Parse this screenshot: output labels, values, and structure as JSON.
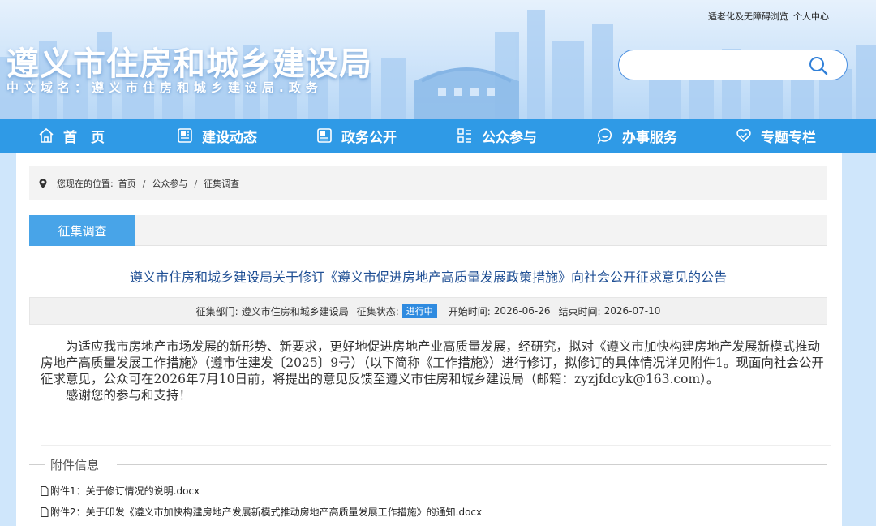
{
  "header": {
    "accessibility_link": "适老化及无障碍浏览",
    "user_center_link": "个人中心",
    "site_title": "遵义市住房和城乡建设局",
    "site_domain": "中文域名：遵义市住房和城乡建设局.政务",
    "search": {
      "placeholder": "",
      "value": ""
    }
  },
  "nav": {
    "items": [
      {
        "label": "首　页",
        "icon": "home-icon"
      },
      {
        "label": "建设动态",
        "icon": "news-icon"
      },
      {
        "label": "政务公开",
        "icon": "document-icon"
      },
      {
        "label": "公众参与",
        "icon": "list-icon"
      },
      {
        "label": "办事服务",
        "icon": "chat-icon"
      },
      {
        "label": "专题专栏",
        "icon": "heart-icon"
      }
    ],
    "colors": {
      "background": "#2f9ae6",
      "text": "#ffffff"
    }
  },
  "breadcrumb": {
    "prefix": "您现在的位置:",
    "items": [
      "首页",
      "公众参与",
      "征集调查"
    ],
    "separator": "/"
  },
  "section": {
    "tab_label": "征集调查",
    "accent": "#48a4e8"
  },
  "article": {
    "title": "遵义市住房和城乡建设局关于修订《遵义市促进房地产高质量发展政策措施》向社会公开征求意见的公告",
    "meta": {
      "dept_label": "征集部门:",
      "dept_value": "遵义市住房和城乡建设局",
      "status_label": "征集状态:",
      "status_value": "进行中",
      "start_label": "开始时间:",
      "start_value": "2026-06-26",
      "end_label": "结束时间:",
      "end_value": "2026-07-10"
    },
    "paragraphs": [
      "为适应我市房地产市场发展的新形势、新要求，更好地促进房地产业高质量发展，经研究，拟对《遵义市加快构建房地产发展新模式推动房地产高质量发展工作措施》（遵市住建发〔2025〕9号）（以下简称《工作措施》）进行修订，拟修订的具体情况详见附件1。现面向社会公开征求意见，公众可在2026年7月10日前，将提出的意见反馈至遵义市住房和城乡建设局（邮箱：zyzjfdcyk@163.com）。",
      "感谢您的参与和支持！"
    ]
  },
  "attachments": {
    "legend": "附件信息",
    "items": [
      "附件1：关于修订情况的说明.docx",
      "附件2：关于印发《遵义市加快构建房地产发展新模式推动房地产高质量发展工作措施》的通知.docx"
    ]
  }
}
